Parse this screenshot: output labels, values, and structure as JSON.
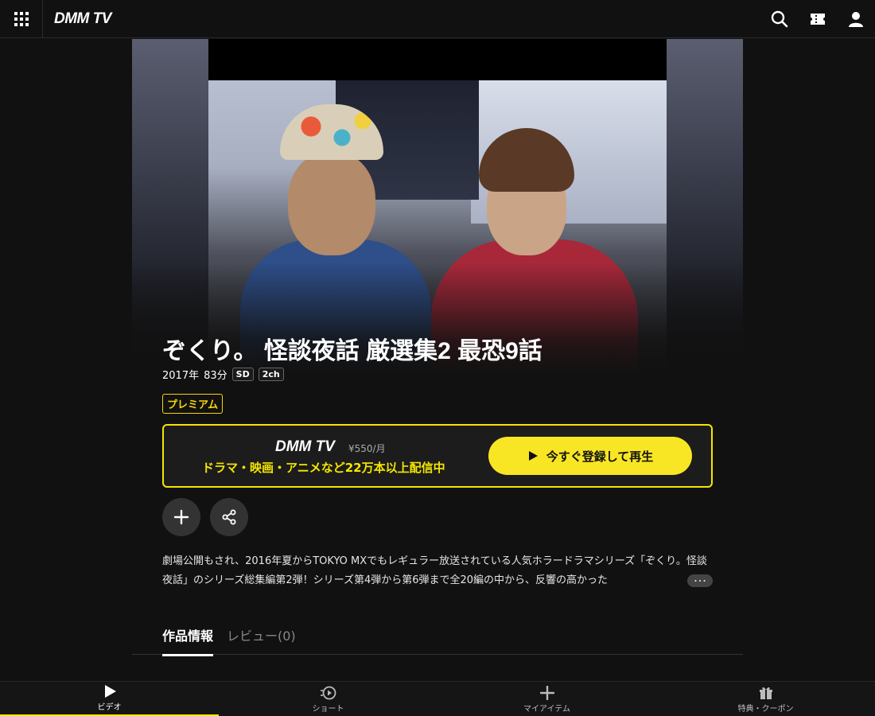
{
  "header": {
    "logo": "DMM TV"
  },
  "title": {
    "main": "ぞくり。 怪談夜話 厳選集2 最恐9話"
  },
  "meta": {
    "year": "2017年",
    "duration": "83分",
    "quality": "SD",
    "audio": "2ch",
    "badge": "プレミアム"
  },
  "promo": {
    "logo": "DMM TV",
    "price": "¥550/月",
    "subtitle": "ドラマ・映画・アニメなど22万本以上配信中",
    "cta": "今すぐ登録して再生"
  },
  "description": {
    "text": "劇場公開もされ、2016年夏からTOKYO MXでもレギュラー放送されている人気ホラードラマシリーズ「ぞくり。怪談夜話」のシリーズ総集編第2弾！シリーズ第4弾から第6弾まで全20編の中から、反響の高かった",
    "more": "･･･"
  },
  "tabs": [
    {
      "label": "作品情報"
    },
    {
      "label": "レビュー(0)"
    }
  ],
  "bottom_nav": [
    {
      "label": "ビデオ",
      "icon": "play-icon"
    },
    {
      "label": "ショート",
      "icon": "short-icon"
    },
    {
      "label": "マイアイテム",
      "icon": "plus-icon"
    },
    {
      "label": "特典・クーポン",
      "icon": "gift-icon"
    }
  ],
  "colors": {
    "accent": "#f5e600",
    "background": "#111111"
  }
}
